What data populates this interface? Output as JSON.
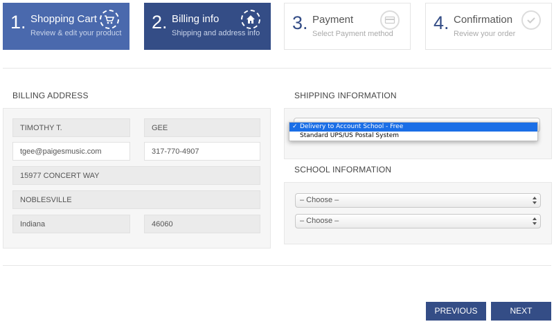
{
  "steps": [
    {
      "number": "1.",
      "title": "Shopping Cart",
      "subtitle": "Review & edit your product",
      "icon": "cart-icon",
      "state": "done"
    },
    {
      "number": "2.",
      "title": "Billing info",
      "subtitle": "Shipping and address info",
      "icon": "home-icon",
      "state": "active"
    },
    {
      "number": "3.",
      "title": "Payment",
      "subtitle": "Select Payment method",
      "icon": "credit-card-icon",
      "state": "todo"
    },
    {
      "number": "4.",
      "title": "Confirmation",
      "subtitle": "Review your order",
      "icon": "check-icon",
      "state": "todo"
    }
  ],
  "billing": {
    "title": "BILLING ADDRESS",
    "first_name": "TIMOTHY T.",
    "last_name": "GEE",
    "email": "tgee@paigesmusic.com",
    "phone": "317-770-4907",
    "address": "15977 CONCERT WAY",
    "city": "NOBLESVILLE",
    "state": "Indiana",
    "zip": "46060"
  },
  "shipping": {
    "title": "SHIPPING INFORMATION",
    "options": [
      "Delivery to Account School - Free",
      "Standard UPS/US Postal System"
    ],
    "selected_index": 0
  },
  "school": {
    "title": "SCHOOL INFORMATION",
    "select1": "– Choose –",
    "select2": "– Choose –"
  },
  "buttons": {
    "previous": "PREVIOUS",
    "next": "NEXT"
  },
  "colors": {
    "active": "#344d86",
    "done": "#4a69ad",
    "highlight": "#1a6ee6"
  }
}
